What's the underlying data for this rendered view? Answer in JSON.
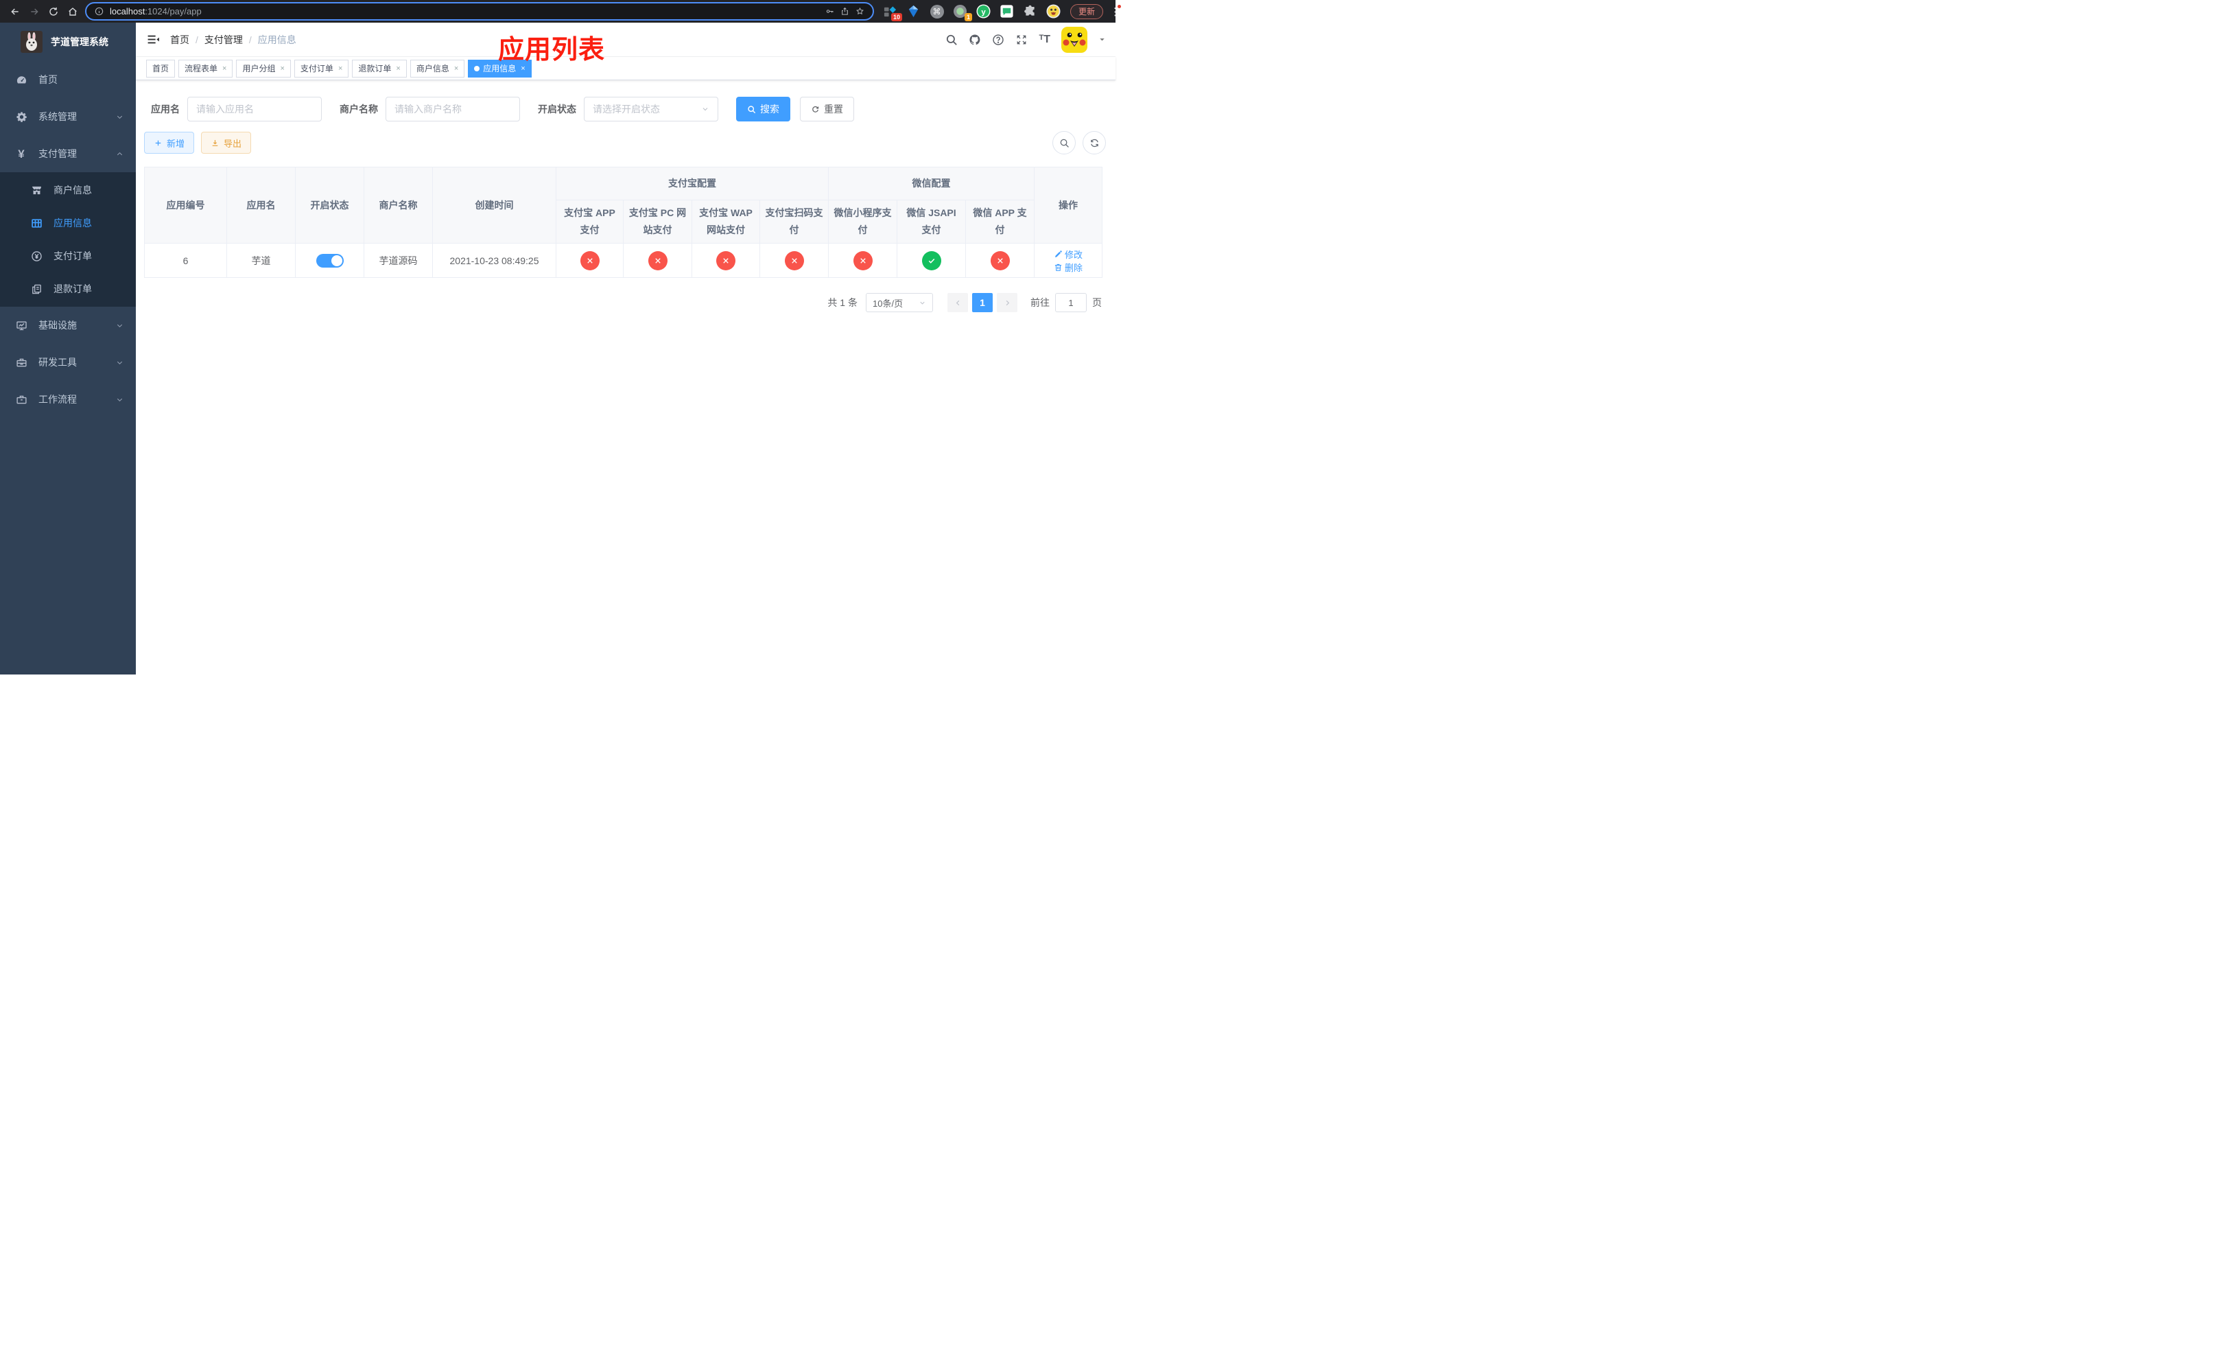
{
  "colors": {
    "primary": "#409eff",
    "success": "#13bf5e",
    "danger": "#f9544b",
    "warning": "#e6a23c",
    "annotation": "#fb1f10",
    "sidebar_bg": "#304156",
    "submenu_bg": "#1f2d3d"
  },
  "annotation": "应用列表",
  "browser": {
    "url_host": "localhost",
    "url_rest": ":1024/pay/app",
    "update_button": "更新",
    "badge_10": "10",
    "badge_1": "1",
    "ext_y_letter": "y",
    "cmd_glyph": "⌘"
  },
  "sidebar": {
    "title": "芋道管理系统",
    "menu": [
      {
        "label": "首页",
        "slug": "home",
        "icon": "dashboard-icon"
      },
      {
        "label": "系统管理",
        "slug": "system",
        "icon": "gear-icon",
        "chevron": "down"
      },
      {
        "label": "支付管理",
        "slug": "payment",
        "icon": "yen-icon",
        "chevron": "up",
        "children": [
          {
            "label": "商户信息",
            "slug": "merchant-info",
            "icon": "shop-icon"
          },
          {
            "label": "应用信息",
            "slug": "app-info",
            "icon": "grid-icon",
            "active": true
          },
          {
            "label": "支付订单",
            "slug": "pay-order",
            "icon": "pay-order-icon"
          },
          {
            "label": "退款订单",
            "slug": "refund-order",
            "icon": "refund-icon"
          }
        ]
      },
      {
        "label": "基础设施",
        "slug": "infrastructure",
        "icon": "monitor-icon",
        "chevron": "down"
      },
      {
        "label": "研发工具",
        "slug": "dev-tools",
        "icon": "toolbox-icon",
        "chevron": "down"
      },
      {
        "label": "工作流程",
        "slug": "workflow",
        "icon": "briefcase-icon",
        "chevron": "down"
      }
    ]
  },
  "navbar": {
    "breadcrumb": [
      "首页",
      "支付管理",
      "应用信息"
    ]
  },
  "tabs": [
    {
      "label": "首页",
      "slug": "home"
    },
    {
      "label": "流程表单",
      "slug": "process-form",
      "closable": true
    },
    {
      "label": "用户分组",
      "slug": "user-group",
      "closable": true
    },
    {
      "label": "支付订单",
      "slug": "pay-order",
      "closable": true
    },
    {
      "label": "退款订单",
      "slug": "refund-order",
      "closable": true
    },
    {
      "label": "商户信息",
      "slug": "merchant-info",
      "closable": true
    },
    {
      "label": "应用信息",
      "slug": "app-info",
      "closable": true,
      "active": true
    }
  ],
  "filters": {
    "app_name": {
      "label": "应用名",
      "placeholder": "请输入应用名"
    },
    "merchant": {
      "label": "商户名称",
      "placeholder": "请输入商户名称"
    },
    "status": {
      "label": "开启状态",
      "placeholder": "请选择开启状态"
    },
    "search": "搜索",
    "reset": "重置"
  },
  "toolbar": {
    "add": "新增",
    "export": "导出"
  },
  "table": {
    "plain_columns": [
      "应用编号",
      "应用名",
      "开启状态",
      "商户名称",
      "创建时间"
    ],
    "groups": [
      {
        "label": "支付宝配置",
        "children": [
          "支付宝 APP 支付",
          "支付宝 PC 网站支付",
          "支付宝 WAP 网站支付",
          "支付宝扫码支付"
        ]
      },
      {
        "label": "微信配置",
        "children": [
          "微信小程序支付",
          "微信 JSAPI 支付",
          "微信 APP 支付"
        ]
      }
    ],
    "actions_column": "操作",
    "rows": [
      {
        "id": "6",
        "name": "芋道",
        "enabled": true,
        "merchant": "芋道源码",
        "created_at": "2021-10-23 08:49:25",
        "channels": [
          false,
          false,
          false,
          false,
          false,
          true,
          false
        ],
        "actions": [
          {
            "label": "修改",
            "icon": "edit-icon"
          },
          {
            "label": "删除",
            "icon": "delete-icon"
          }
        ]
      }
    ]
  },
  "pagination": {
    "total": "共 1 条",
    "page_size": "10条/页",
    "current_page": "1",
    "goto_label": "前往",
    "goto_value": "1",
    "goto_unit": "页"
  }
}
